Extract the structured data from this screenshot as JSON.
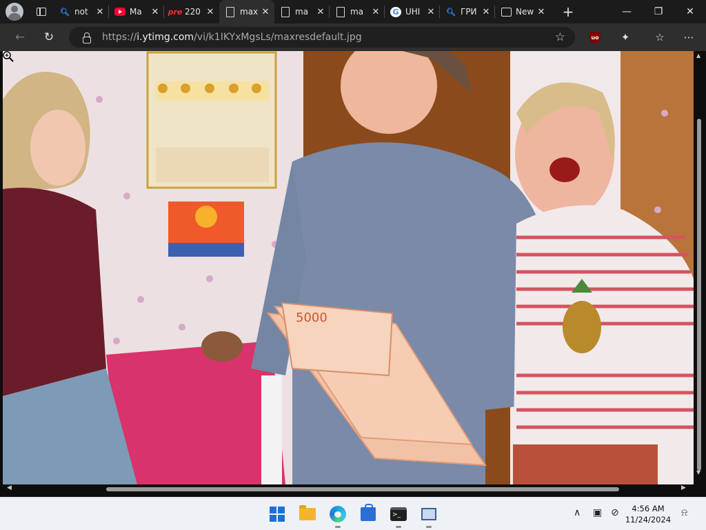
{
  "tabs": [
    {
      "title": "not",
      "favicon": "search-icon",
      "active": false
    },
    {
      "title": "Ma",
      "favicon": "youtube-icon",
      "active": false
    },
    {
      "title": "220",
      "favicon": "pre-icon",
      "favicon_text": "pre",
      "active": false
    },
    {
      "title": "max",
      "favicon": "document-icon",
      "active": true
    },
    {
      "title": "ma",
      "favicon": "document-icon",
      "active": false
    },
    {
      "title": "ma",
      "favicon": "document-icon",
      "active": false
    },
    {
      "title": "UHI",
      "favicon": "google-icon",
      "favicon_text": "G",
      "active": false
    },
    {
      "title": "ГРИ",
      "favicon": "search-icon",
      "active": false
    },
    {
      "title": "New",
      "favicon": "news-icon",
      "active": false
    }
  ],
  "address": {
    "prefix": "https://",
    "host": "i.ytimg.com",
    "path": "/vi/k1IKYxMgsLs/maxresdefault.jpg"
  },
  "extensions": {
    "ublock_label": "uo"
  },
  "photo": {
    "description_icon": "image-content",
    "banknote_text": "5000"
  },
  "taskbar": {
    "apps": [
      "start-icon",
      "file-explorer-icon",
      "edge-icon",
      "store-icon",
      "terminal-icon",
      "remote-desktop-icon"
    ],
    "terminal_glyph": ">_",
    "time": "4:56 AM",
    "date": "11/24/2024"
  },
  "colors": {
    "tab_strip": "#1b1b1b",
    "toolbar": "#2e2e2e",
    "accent_search": "#2f8cff",
    "youtube": "#ff0033"
  }
}
